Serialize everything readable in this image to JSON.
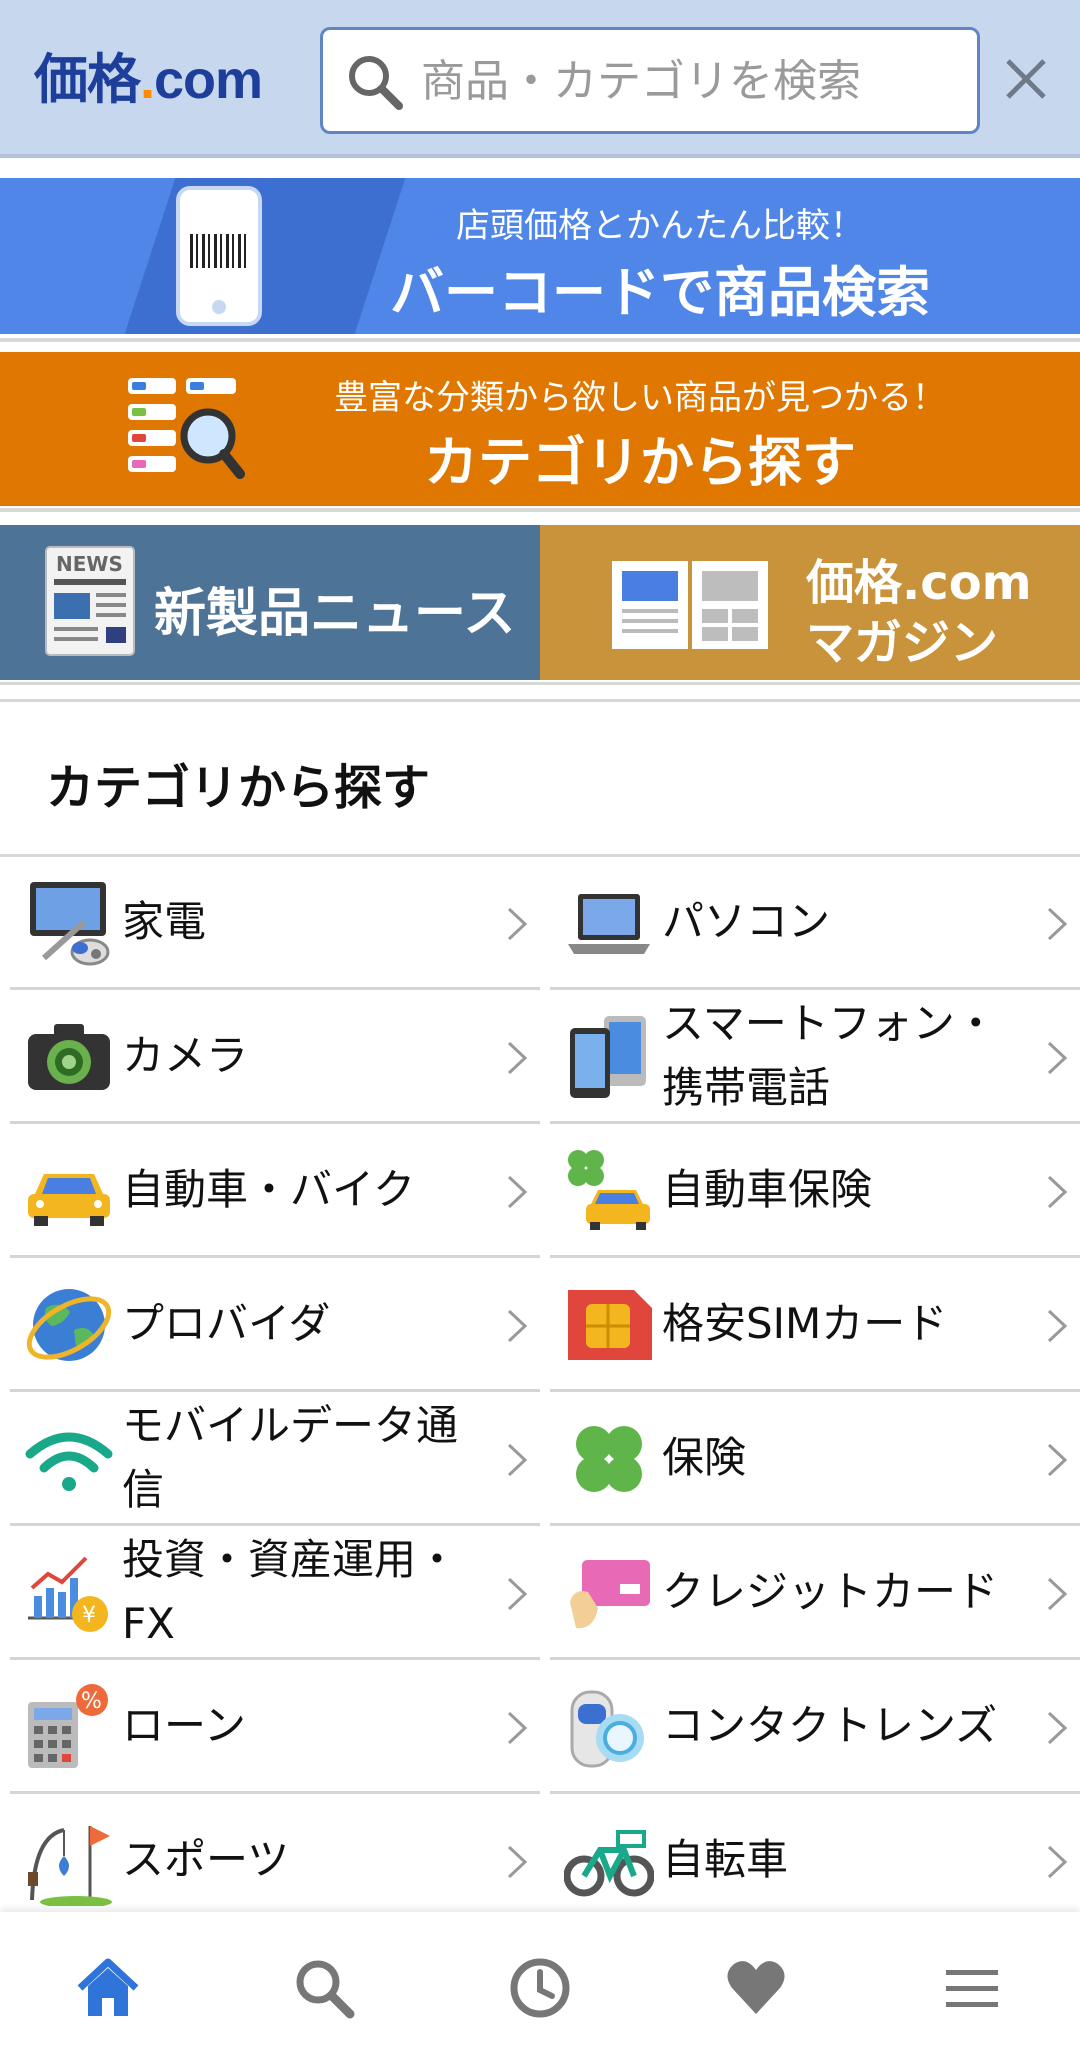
{
  "header": {
    "logo_main": "価格",
    "logo_dot": ".",
    "logo_com": "com",
    "search_placeholder": "商品・カテゴリを検索"
  },
  "banners": {
    "barcode": {
      "sub": "店頭価格とかんたん比較！",
      "main": "バーコードで商品検索"
    },
    "category": {
      "sub": "豊富な分類から欲しい商品が見つかる！",
      "main": "カテゴリから探す"
    },
    "news": {
      "label": "新製品ニュース",
      "icon_text": "NEWS"
    },
    "magazine": {
      "line1": "価格.com",
      "line2": "マガジン"
    }
  },
  "section": {
    "title": "カテゴリから探す"
  },
  "categories": [
    {
      "label": "家電",
      "icon": "vacuum-monitor-icon"
    },
    {
      "label": "パソコン",
      "icon": "laptop-icon"
    },
    {
      "label": "カメラ",
      "icon": "camera-icon"
    },
    {
      "label": "スマートフォン・携帯電話",
      "icon": "smartphone-icon"
    },
    {
      "label": "自動車・バイク",
      "icon": "car-icon"
    },
    {
      "label": "自動車保険",
      "icon": "car-insurance-icon"
    },
    {
      "label": "プロバイダ",
      "icon": "globe-icon"
    },
    {
      "label": "格安SIMカード",
      "icon": "sim-card-icon"
    },
    {
      "label": "モバイルデータ通信",
      "icon": "wifi-icon"
    },
    {
      "label": "保険",
      "icon": "clover-icon"
    },
    {
      "label": "投資・資産運用・FX",
      "icon": "investment-icon"
    },
    {
      "label": "クレジットカード",
      "icon": "credit-card-icon"
    },
    {
      "label": "ローン",
      "icon": "calculator-icon"
    },
    {
      "label": "コンタクトレンズ",
      "icon": "contact-lens-icon"
    },
    {
      "label": "スポーツ",
      "icon": "sports-icon"
    },
    {
      "label": "自転車",
      "icon": "bicycle-icon"
    }
  ],
  "tabbar": [
    "home-icon",
    "search-icon",
    "history-icon",
    "favorite-icon",
    "menu-icon"
  ],
  "colors": {
    "header_bg": "#c7d8ee",
    "barcode_banner": "#4f86e8",
    "category_banner": "#df7700",
    "news_banner": "#4d7396",
    "magazine_banner": "#c9933b",
    "active_tab": "#2f74d8"
  }
}
